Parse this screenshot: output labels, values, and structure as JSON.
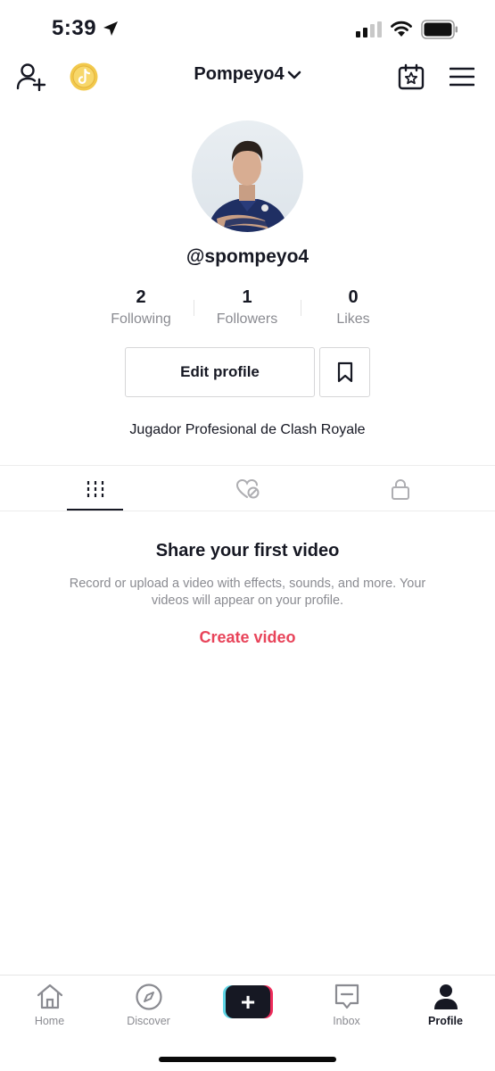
{
  "status_bar": {
    "time": "5:39"
  },
  "header": {
    "username": "Pompeyo4"
  },
  "profile": {
    "handle": "@spompeyo4",
    "bio": "Jugador Profesional de Clash Royale",
    "stats": [
      {
        "value": "2",
        "label": "Following"
      },
      {
        "value": "1",
        "label": "Followers"
      },
      {
        "value": "0",
        "label": "Likes"
      }
    ],
    "edit_label": "Edit profile"
  },
  "tabs": [
    "videos-grid-icon",
    "liked-hidden-icon",
    "private-lock-icon"
  ],
  "empty_state": {
    "title": "Share your first video",
    "description": "Record or upload a video with effects, sounds, and more. Your videos will appear on your profile.",
    "cta": "Create video"
  },
  "bottom_nav": [
    {
      "label": "Home",
      "icon": "home-icon"
    },
    {
      "label": "Discover",
      "icon": "compass-icon"
    },
    {
      "label": "",
      "icon": "create-plus-icon"
    },
    {
      "label": "Inbox",
      "icon": "inbox-icon"
    },
    {
      "label": "Profile",
      "icon": "person-icon"
    }
  ],
  "colors": {
    "accent": "#e8445a",
    "text": "#161823",
    "secondary": "#8a8b91"
  }
}
